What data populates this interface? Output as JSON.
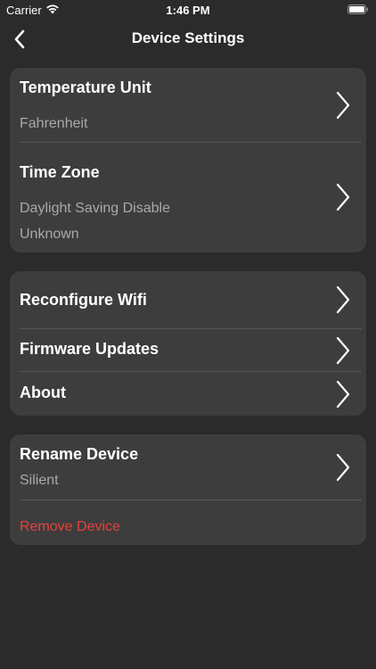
{
  "status_bar": {
    "carrier": "Carrier",
    "time": "1:46 PM"
  },
  "nav": {
    "title": "Device Settings",
    "back_icon": "chevron-left-icon"
  },
  "settings": {
    "temperature_unit": {
      "title": "Temperature Unit",
      "value": "Fahrenheit"
    },
    "time_zone": {
      "title": "Time Zone",
      "dst": "Daylight Saving Disable",
      "zone": "Unknown"
    },
    "reconfigure_wifi": {
      "title": "Reconfigure Wifi"
    },
    "firmware_updates": {
      "title": "Firmware Updates"
    },
    "about": {
      "title": "About"
    },
    "rename_device": {
      "title": "Rename Device",
      "value": "Silient"
    },
    "remove_device": {
      "label": "Remove Device"
    }
  },
  "colors": {
    "background": "#2b2b2b",
    "card": "#3d3d3d",
    "secondary_text": "#a9a9a9",
    "danger": "#e8403c"
  }
}
